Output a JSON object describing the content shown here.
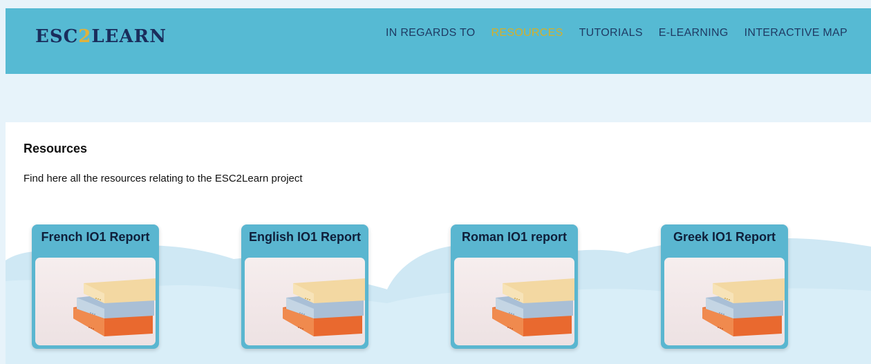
{
  "header": {
    "logo": {
      "part1": "ESC",
      "part2": "2",
      "part3": "LEARN"
    },
    "nav": [
      {
        "label": "IN REGARDS TO",
        "active": false
      },
      {
        "label": "RESOURCES",
        "active": true
      },
      {
        "label": "TUTORIALS",
        "active": false
      },
      {
        "label": "E-LEARNING",
        "active": false
      },
      {
        "label": "INTERACTIVE MAP",
        "active": false
      }
    ]
  },
  "main": {
    "title": "Resources",
    "description": "Find here all the resources relating to the ESC2Learn project",
    "cards": [
      {
        "title": "French IO1 Report",
        "image": "stack-of-books-image"
      },
      {
        "title": "English IO1 Report",
        "image": "stack-of-books-image"
      },
      {
        "title": "Roman IO1 report",
        "image": "stack-of-books-image"
      },
      {
        "title": "Greek IO1 Report",
        "image": "stack-of-books-image"
      }
    ]
  },
  "colors": {
    "header_bg": "#56bad3",
    "page_bg": "#e7f3fa",
    "nav_text": "#1f3a63",
    "nav_active": "#d4b02a",
    "logo_text": "#1a2d5c",
    "logo_accent": "#e0b23c",
    "card_bg": "#5ab6d0"
  }
}
